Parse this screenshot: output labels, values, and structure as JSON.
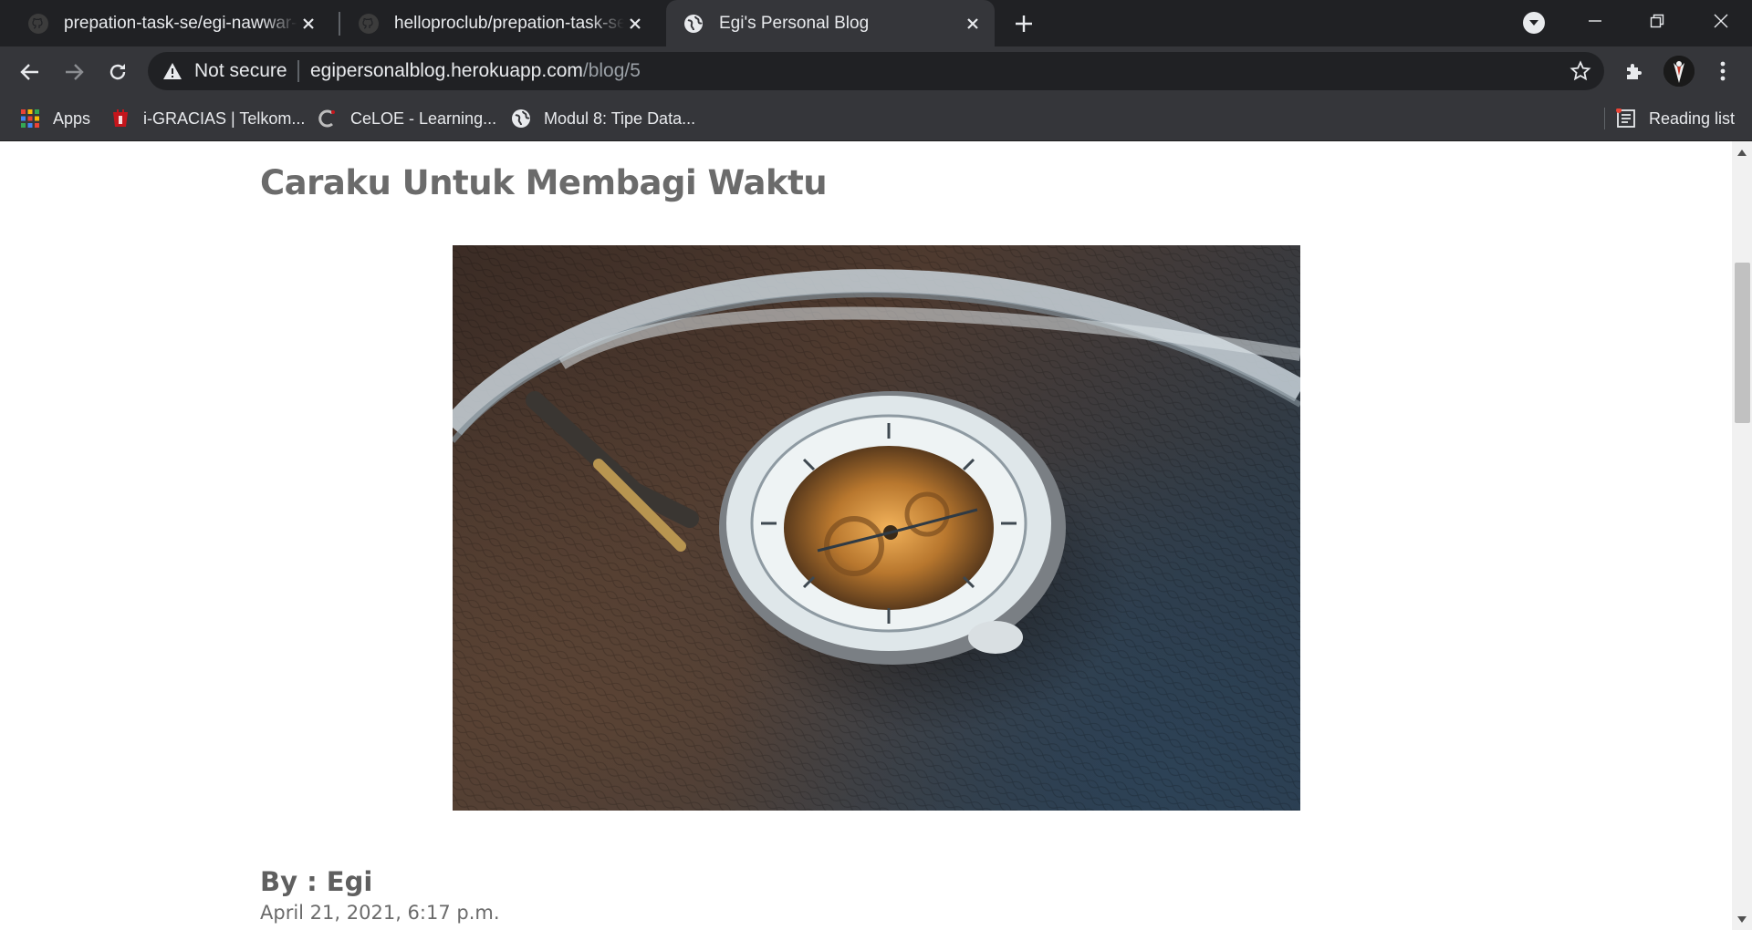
{
  "browser": {
    "tabs": [
      {
        "title": "prepation-task-se/egi-nawwar-su",
        "icon": "github-icon",
        "active": false
      },
      {
        "title": "helloproclub/prepation-task-se: I",
        "icon": "github-icon",
        "active": false
      },
      {
        "title": "Egi's Personal Blog",
        "icon": "globe-icon",
        "active": true
      }
    ],
    "address": {
      "security_label": "Not secure",
      "host": "egipersonalblog.herokuapp.com",
      "path": "/blog/5"
    },
    "bookmarks": [
      {
        "label": "Apps",
        "icon": "apps-grid-icon"
      },
      {
        "label": "i-GRACIAS | Telkom...",
        "icon": "telkom-icon"
      },
      {
        "label": "CeLOE - Learning...",
        "icon": "celoe-icon"
      },
      {
        "label": "Modul 8: Tipe Data...",
        "icon": "globe-icon"
      }
    ],
    "reading_list_label": "Reading list"
  },
  "post": {
    "title": "Caraku Untuk Membagi Waktu",
    "image_alt": "pocket-watch-photo",
    "author": "By : Egi",
    "date": "April 21, 2021, 6:17 p.m."
  },
  "colors": {
    "tab_strip": "#202124",
    "toolbar": "#35363a",
    "title_text": "#6b6b6b"
  }
}
